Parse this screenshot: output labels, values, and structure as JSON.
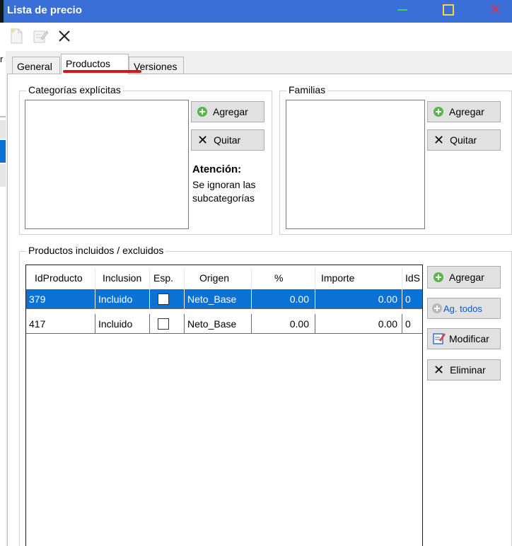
{
  "window": {
    "title": "Lista de precio",
    "close_glyph": "✕"
  },
  "toolbar": {
    "new_icon": "new-document-icon",
    "edit_icon": "edit-document-icon",
    "delete_glyph": "✕"
  },
  "sliver": {
    "glyph": "r"
  },
  "tabs": [
    {
      "label": "General"
    },
    {
      "label": "Productos",
      "active": true
    },
    {
      "label": "Versiones"
    }
  ],
  "categorias": {
    "title": "Categorías explícitas",
    "add_label": "Agregar",
    "remove_label": "Quitar",
    "note_title": "Atención:",
    "note_lines": [
      "Se ignoran las",
      "subcategorías"
    ]
  },
  "familias": {
    "title": "Familias",
    "add_label": "Agregar",
    "remove_label": "Quitar"
  },
  "productos": {
    "title": "Productos incluidos / excluidos",
    "columns": [
      "IdProducto",
      "Inclusion",
      "Esp.",
      "Origen",
      "%",
      "Importe",
      "IdS"
    ],
    "rows": [
      {
        "id": "379",
        "inclusion": "Incluido",
        "esp": false,
        "origen": "Neto_Base",
        "pct": "0.00",
        "importe": "0.00",
        "ids": "0",
        "selected": true
      },
      {
        "id": "417",
        "inclusion": "Incluido",
        "esp": false,
        "origen": "Neto_Base",
        "pct": "0.00",
        "importe": "0.00",
        "ids": "0",
        "selected": false
      }
    ],
    "buttons": {
      "add": "Agregar",
      "add_all": "Ag. todos",
      "modify": "Modificar",
      "delete": "Eliminar"
    }
  },
  "colors": {
    "titlebar": "#3a6fd8",
    "selection": "#0a72d4",
    "accent_underline": "#d9141c"
  }
}
